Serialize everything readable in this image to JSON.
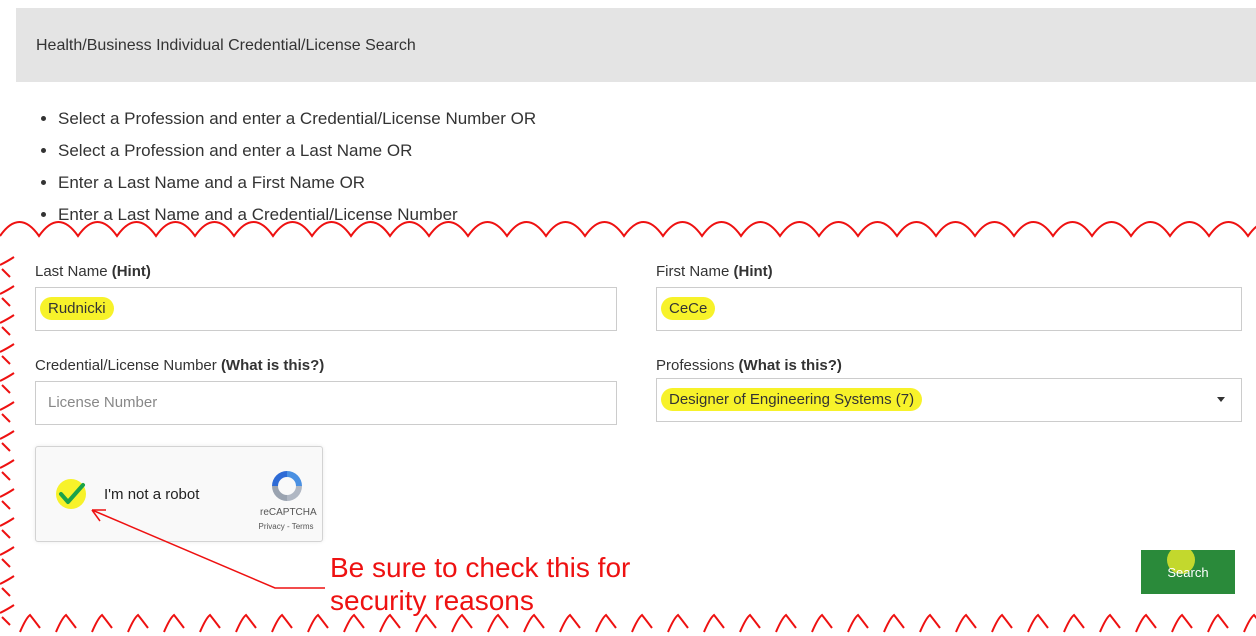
{
  "header": {
    "title": "Health/Business Individual Credential/License Search"
  },
  "instructions": [
    "Select a Profession and enter a Credential/License Number OR",
    "Select a Profession and enter a Last Name OR",
    "Enter a Last Name and a First Name OR",
    "Enter a Last Name and a Credential/License Number"
  ],
  "form": {
    "last_name": {
      "label": "Last Name",
      "hint": "(Hint)",
      "value": "Rudnicki"
    },
    "first_name": {
      "label": "First Name",
      "hint": "(Hint)",
      "value": "CeCe"
    },
    "license": {
      "label": "Credential/License Number",
      "hint": "(What is this?)",
      "placeholder": "License Number"
    },
    "profession": {
      "label": "Professions",
      "hint": "(What is this?)",
      "selected": "Designer of Engineering Systems (7)"
    }
  },
  "captcha": {
    "label": "I'm not a robot",
    "brand": "reCAPTCHA",
    "privacy": "Privacy",
    "separator": "-",
    "terms": "Terms",
    "checked": true
  },
  "search_button": {
    "label": "Search"
  },
  "annotation": {
    "line1": "Be sure to check this for",
    "line2": "security reasons",
    "color": "#ee1111"
  },
  "colors": {
    "highlight": "#f7f22a",
    "button": "#2a8a3a",
    "header_bg": "#e4e4e4"
  }
}
